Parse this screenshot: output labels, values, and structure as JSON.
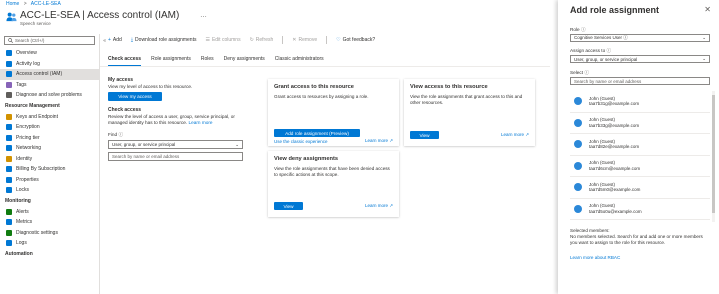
{
  "breadcrumb": {
    "home": "Home",
    "sep": ">",
    "resource": "ACC-LE-SEA"
  },
  "header": {
    "title": "ACC-LE-SEA | Access control (IAM)",
    "subtitle": "Speech service",
    "more": "…"
  },
  "nav": {
    "search_placeholder": "Search (Ctrl+/)",
    "collapse": "«",
    "items": [
      {
        "label": "Overview",
        "color": "#0078d4"
      },
      {
        "label": "Activity log",
        "color": "#0078d4"
      },
      {
        "label": "Access control (IAM)",
        "color": "#0078d4"
      },
      {
        "label": "Tags",
        "color": "#8764b8"
      },
      {
        "label": "Diagnose and solve problems",
        "color": "#605e5c"
      }
    ],
    "section_resource_management": "Resource Management",
    "resource_items": [
      {
        "label": "Keys and Endpoint",
        "color": "#d29200"
      },
      {
        "label": "Encryption",
        "color": "#0078d4"
      },
      {
        "label": "Pricing tier",
        "color": "#0078d4"
      },
      {
        "label": "Networking",
        "color": "#0078d4"
      },
      {
        "label": "Identity",
        "color": "#d29200"
      },
      {
        "label": "Billing By Subscription",
        "color": "#0078d4"
      },
      {
        "label": "Properties",
        "color": "#0078d4"
      },
      {
        "label": "Locks",
        "color": "#0078d4"
      }
    ],
    "section_monitoring": "Monitoring",
    "monitoring_items": [
      {
        "label": "Alerts",
        "color": "#107c10"
      },
      {
        "label": "Metrics",
        "color": "#0078d4"
      },
      {
        "label": "Diagnostic settings",
        "color": "#107c10"
      },
      {
        "label": "Logs",
        "color": "#0078d4"
      }
    ],
    "section_automation": "Automation"
  },
  "toolbar": {
    "add": "Add",
    "download": "Download role assignments",
    "edit_columns": "Edit columns",
    "refresh": "Refresh",
    "remove": "Remove",
    "feedback": "Got feedback?"
  },
  "tabs": [
    "Check access",
    "Role assignments",
    "Roles",
    "Deny assignments",
    "Classic administrators"
  ],
  "check_access": {
    "my_access_title": "My access",
    "my_access_desc": "View my level of access to this resource.",
    "view_my_access": "View my access",
    "check_access_title": "Check access",
    "check_access_desc": "Review the level of access a user, group, service principal, or managed identity has to this resource.",
    "learn_more": "Learn more",
    "find_label": "Find",
    "find_select": "User, group, or service principal",
    "search_placeholder": "Search by name or email address"
  },
  "cards": {
    "grant": {
      "title": "Grant access to this resource",
      "desc": "Grant access to resources by assigning a role.",
      "button": "Add role assignment (Preview)",
      "classic": "Use the classic experience",
      "link": "Learn more"
    },
    "view_access": {
      "title": "View access to this resource",
      "desc": "View the role assignments that grant access to this and other resources.",
      "button": "View",
      "link": "Learn more"
    },
    "deny": {
      "title": "View deny assignments",
      "desc": "View the role assignments that have been denied access to specific actions at this scope.",
      "button": "View",
      "link": "Learn more"
    }
  },
  "panel": {
    "title": "Add role assignment",
    "close": "✕",
    "role_label": "Role",
    "role_value": "Cognitive Services User",
    "assign_label": "Assign access to",
    "assign_value": "User, group, or service principal",
    "select_label": "Select",
    "select_placeholder": "Search by name or email address",
    "users": [
      {
        "name": "John (Guest)",
        "email": "taa7b31g@example.com"
      },
      {
        "name": "John (Guest)",
        "email": "taa7b33g@example.com"
      },
      {
        "name": "John (Guest)",
        "email": "taa7d82e@example.com"
      },
      {
        "name": "John (Guest)",
        "email": "taa7d6cm@example.com"
      },
      {
        "name": "John (Guest)",
        "email": "taa7d5m0@example.com"
      },
      {
        "name": "John (Guest)",
        "email": "taa7d5o0u@example.com"
      }
    ],
    "selected_members_label": "Selected members:",
    "selected_members_desc": "No members selected. Search for and add one or more members you want to assign to the role for this resource.",
    "learn_more": "Learn more about RBAC"
  }
}
